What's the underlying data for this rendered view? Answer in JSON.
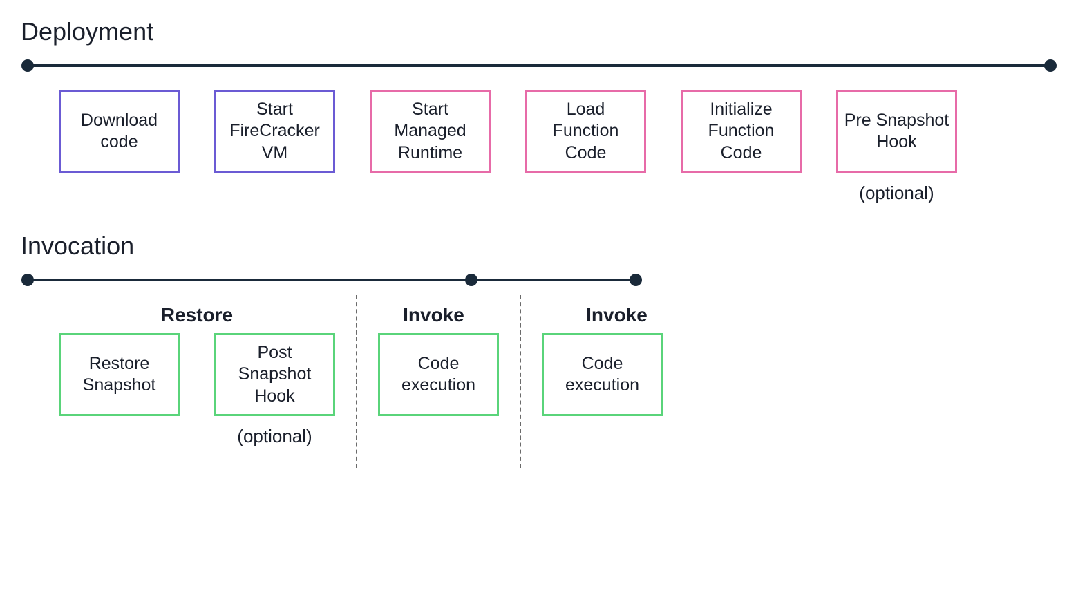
{
  "deployment": {
    "title": "Deployment",
    "steps": [
      {
        "label": "Download code",
        "color": "purple"
      },
      {
        "label": "Start FireCracker VM",
        "color": "purple"
      },
      {
        "label": "Start Managed Runtime",
        "color": "pink"
      },
      {
        "label": "Load Function Code",
        "color": "pink"
      },
      {
        "label": "Initialize Function Code",
        "color": "pink"
      },
      {
        "label": "Pre Snapshot Hook",
        "color": "pink",
        "note": "(optional)"
      }
    ]
  },
  "invocation": {
    "title": "Invocation",
    "phases": {
      "restore": {
        "label": "Restore",
        "steps": [
          {
            "label": "Restore Snapshot",
            "color": "green"
          },
          {
            "label": "Post Snapshot Hook",
            "color": "green",
            "note": "(optional)"
          }
        ]
      },
      "invoke1": {
        "label": "Invoke",
        "steps": [
          {
            "label": "Code execution",
            "color": "green"
          }
        ]
      },
      "invoke2": {
        "label": "Invoke",
        "steps": [
          {
            "label": "Code execution",
            "color": "green"
          }
        ]
      }
    }
  }
}
